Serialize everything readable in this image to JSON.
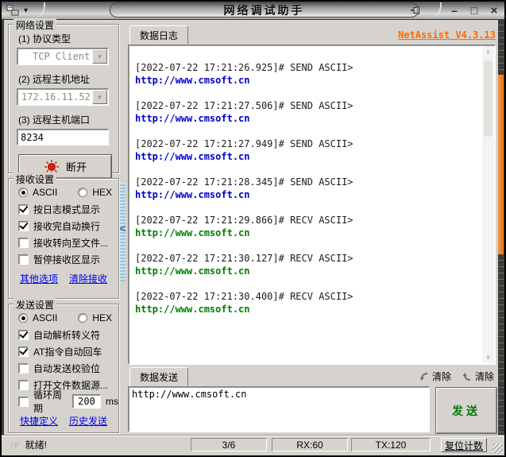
{
  "titlebar": {
    "title": "网络调试助手",
    "menu_arrow": "▾",
    "minimize": "–",
    "maximize": "□",
    "close": "×"
  },
  "sidebar": {
    "network": {
      "title": "网络设置",
      "protocol_label": "(1) 协议类型",
      "protocol_value": "TCP Client",
      "host_label": "(2) 远程主机地址",
      "host_value": "172.16.11.52",
      "port_label": "(3) 远程主机端口",
      "port_value": "8234",
      "disconnect": "断开"
    },
    "receive": {
      "title": "接收设置",
      "ascii": "ASCII",
      "hex": "HEX",
      "ascii_on": true,
      "hex_on": false,
      "options": [
        {
          "label": "按日志模式显示",
          "checked": true
        },
        {
          "label": "接收完自动换行",
          "checked": true
        },
        {
          "label": "接收转向至文件...",
          "checked": false
        },
        {
          "label": "暂停接收区显示",
          "checked": false
        }
      ],
      "link1": "其他选项",
      "link2": "清除接收"
    },
    "send": {
      "title": "发送设置",
      "ascii": "ASCII",
      "hex": "HEX",
      "ascii_on": true,
      "hex_on": false,
      "options": [
        {
          "label": "自动解析转义符",
          "checked": true
        },
        {
          "label": "AT指令自动回车",
          "checked": true
        },
        {
          "label": "自动发送校验位",
          "checked": false
        },
        {
          "label": "打开文件数据源...",
          "checked": false
        }
      ],
      "cycle_label": "循环周期",
      "cycle_checked": false,
      "cycle_value": "200",
      "cycle_unit": "ms",
      "link1": "快捷定义",
      "link2": "历史发送"
    }
  },
  "main": {
    "version": "NetAssist V4.3.13",
    "log_tab": "数据日志",
    "send_tab": "数据发送",
    "clear_recv_label": "清除",
    "clear_send_label": "清除",
    "send_value": "http://www.cmsoft.cn",
    "send_button": "发送",
    "log_entries": [
      {
        "time": "[2022-07-22 17:21:26.925]# SEND ASCII>",
        "content": "http://www.cmsoft.cn",
        "type": "send"
      },
      {
        "time": "[2022-07-22 17:21:27.506]# SEND ASCII>",
        "content": "http://www.cmsoft.cn",
        "type": "send"
      },
      {
        "time": "[2022-07-22 17:21:27.949]# SEND ASCII>",
        "content": "http://www.cmsoft.cn",
        "type": "send"
      },
      {
        "time": "[2022-07-22 17:21:28.345]# SEND ASCII>",
        "content": "http://www.cmsoft.cn",
        "type": "send"
      },
      {
        "time": "[2022-07-22 17:21:29.866]# RECV ASCII>",
        "content": "http://www.cmsoft.cn",
        "type": "recv"
      },
      {
        "time": "[2022-07-22 17:21:30.127]# RECV ASCII>",
        "content": "http://www.cmsoft.cn",
        "type": "recv"
      },
      {
        "time": "[2022-07-22 17:21:30.400]# RECV ASCII>",
        "content": "http://www.cmsoft.cn",
        "type": "recv"
      }
    ]
  },
  "statusbar": {
    "ready_icon": "☞",
    "ready": "就绪!",
    "counter": "3/6",
    "rx": "RX:60",
    "tx": "TX:120",
    "reset": "复位计数"
  },
  "icons": {
    "combo_arrow": "▼",
    "scroll_up": "∧",
    "scroll_down": "∨",
    "collapse": "<"
  },
  "colors": {
    "accent_orange": "#ff6a00",
    "link_blue": "#0000ee",
    "send_text": "#0000cc",
    "recv_text": "#008000",
    "send_button_green": "#007700",
    "frame_thumb_orange": "#e0751f"
  }
}
